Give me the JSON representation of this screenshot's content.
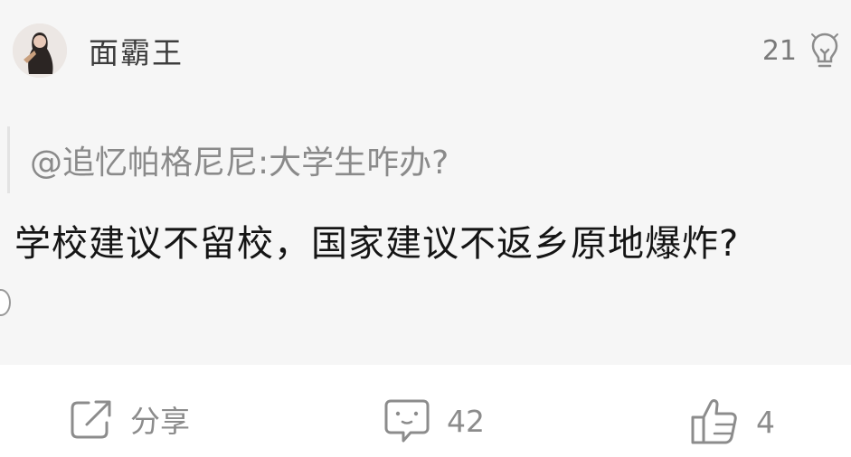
{
  "post": {
    "author": "面霸王",
    "like_count": "21",
    "quote": "@追忆帕格尼尼:大学生咋办?",
    "body": "学校建议不留校，国家建议不返乡原地爆炸?"
  },
  "actions": {
    "share_label": "分享",
    "comment_count": "42",
    "thumbs_count": "4"
  },
  "icons": {
    "like": "lightbulb-icon",
    "share": "share-icon",
    "comment": "comment-icon",
    "thumbs": "thumbs-up-icon"
  },
  "colors": {
    "card_background": "#f6f6f6",
    "icon_gray": "#8c8c8c",
    "quote_gray": "#8a8a8a"
  }
}
